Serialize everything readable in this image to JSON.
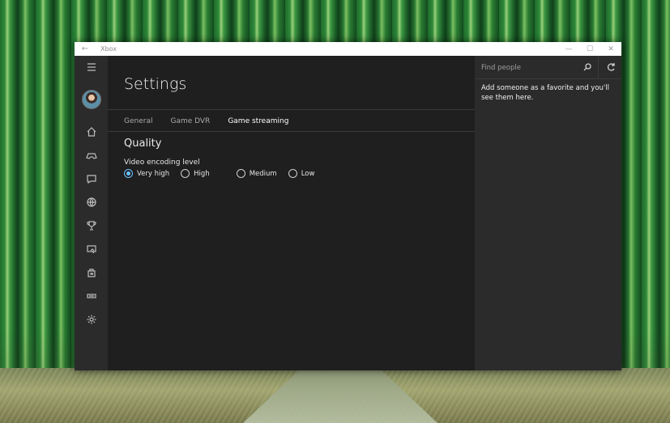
{
  "window": {
    "app_title": "Xbox",
    "controls": {
      "minimize": "—",
      "maximize": "☐",
      "close": "✕"
    }
  },
  "nav": {
    "items": [
      {
        "name": "menu-icon"
      },
      {
        "name": "home-icon"
      },
      {
        "name": "controller-icon"
      },
      {
        "name": "messages-icon"
      },
      {
        "name": "globe-icon"
      },
      {
        "name": "trophy-icon"
      },
      {
        "name": "game-dvr-icon"
      },
      {
        "name": "store-icon"
      },
      {
        "name": "connect-icon"
      },
      {
        "name": "settings-icon"
      }
    ]
  },
  "main": {
    "title": "Settings",
    "tabs": [
      {
        "label": "General",
        "active": false
      },
      {
        "label": "Game DVR",
        "active": false
      },
      {
        "label": "Game streaming",
        "active": true
      }
    ],
    "section_title": "Quality",
    "field_label": "Video encoding level",
    "options": [
      {
        "label": "Very high",
        "checked": true
      },
      {
        "label": "High",
        "checked": false
      },
      {
        "label": "Medium",
        "checked": false
      },
      {
        "label": "Low",
        "checked": false
      }
    ]
  },
  "people": {
    "search_placeholder": "Find people",
    "empty_message": "Add someone as a favorite and you'll see them here."
  },
  "colors": {
    "accent": "#6cc1ff",
    "pane_dark": "#1f1f1f",
    "pane_mid": "#2b2b2b"
  }
}
